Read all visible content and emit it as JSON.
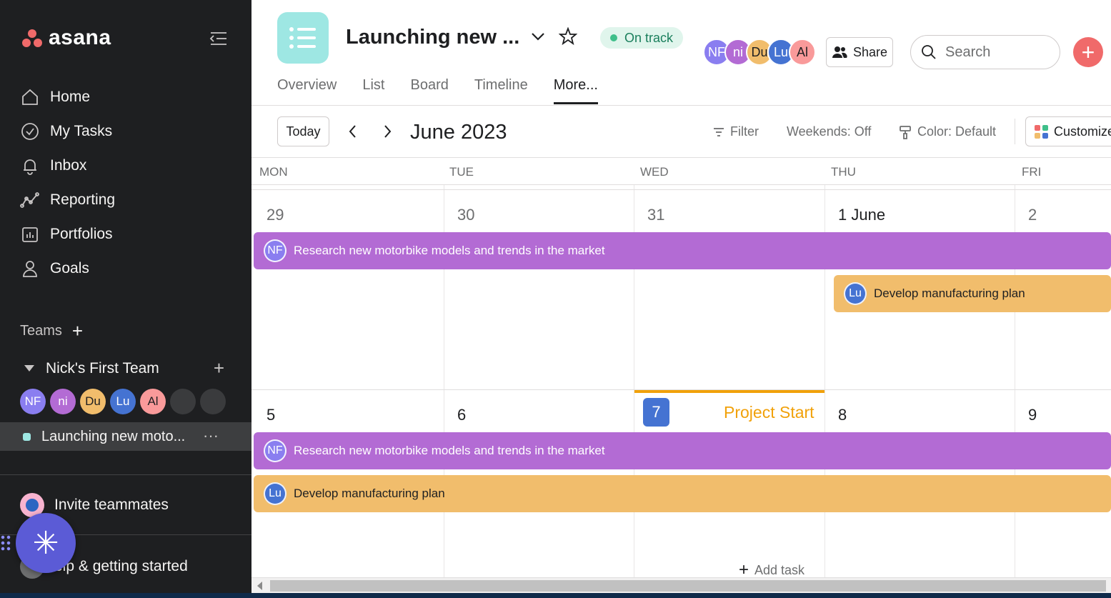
{
  "app": {
    "logo_text": "asana",
    "brand_color": "#f06a6a"
  },
  "sidebar": {
    "nav": [
      {
        "label": "Home",
        "icon": "home-icon"
      },
      {
        "label": "My Tasks",
        "icon": "check-circle-icon"
      },
      {
        "label": "Inbox",
        "icon": "bell-icon"
      },
      {
        "label": "Reporting",
        "icon": "line-chart-icon"
      },
      {
        "label": "Portfolios",
        "icon": "portfolio-icon"
      },
      {
        "label": "Goals",
        "icon": "goals-icon"
      }
    ],
    "teams_label": "Teams",
    "team_name": "Nick's First Team",
    "team_members": [
      {
        "initials": "NF",
        "color": "#8a7ef0"
      },
      {
        "initials": "ni",
        "color": "#b36bd4"
      },
      {
        "initials": "Du",
        "color": "#f1bd6c"
      },
      {
        "initials": "Lu",
        "color": "#4573d2"
      },
      {
        "initials": "Al",
        "color": "#f99a9a"
      }
    ],
    "project_name": "Launching new moto...",
    "invite_label": "Invite teammates",
    "help_label": "elp & getting started"
  },
  "header": {
    "project_title": "Launching new ...",
    "status": "On track",
    "share_label": "Share",
    "search_placeholder": "Search",
    "avatars": [
      {
        "initials": "NF",
        "color": "#8a7ef0"
      },
      {
        "initials": "ni",
        "color": "#b36bd4"
      },
      {
        "initials": "Du",
        "color": "#f1bd6c"
      },
      {
        "initials": "Lu",
        "color": "#4573d2"
      },
      {
        "initials": "Al",
        "color": "#f99a9a"
      }
    ],
    "tabs": [
      {
        "label": "Overview",
        "active": false
      },
      {
        "label": "List",
        "active": false
      },
      {
        "label": "Board",
        "active": false
      },
      {
        "label": "Timeline",
        "active": false
      },
      {
        "label": "More...",
        "active": true
      }
    ]
  },
  "toolbar": {
    "today_label": "Today",
    "month_label": "June 2023",
    "filter_label": "Filter",
    "weekends_label": "Weekends: Off",
    "color_label": "Color: Default",
    "customize_label": "Customize"
  },
  "calendar": {
    "weekdays": [
      "MON",
      "TUE",
      "WED",
      "THU",
      "FRI"
    ],
    "week1_days": [
      "29",
      "30",
      "31",
      "1 June",
      "2"
    ],
    "week2_days": [
      "5",
      "6",
      "7",
      "8",
      "9"
    ],
    "today": "7",
    "milestone": "Project Start",
    "tasks": {
      "research": {
        "title": "Research new motorbike models and trends in the market",
        "assignee": "NF",
        "color": "#b36bd4"
      },
      "develop": {
        "title": "Develop manufacturing plan",
        "assignee": "Lu",
        "color": "#f1bd6c"
      }
    },
    "add_task_label": "Add task"
  }
}
